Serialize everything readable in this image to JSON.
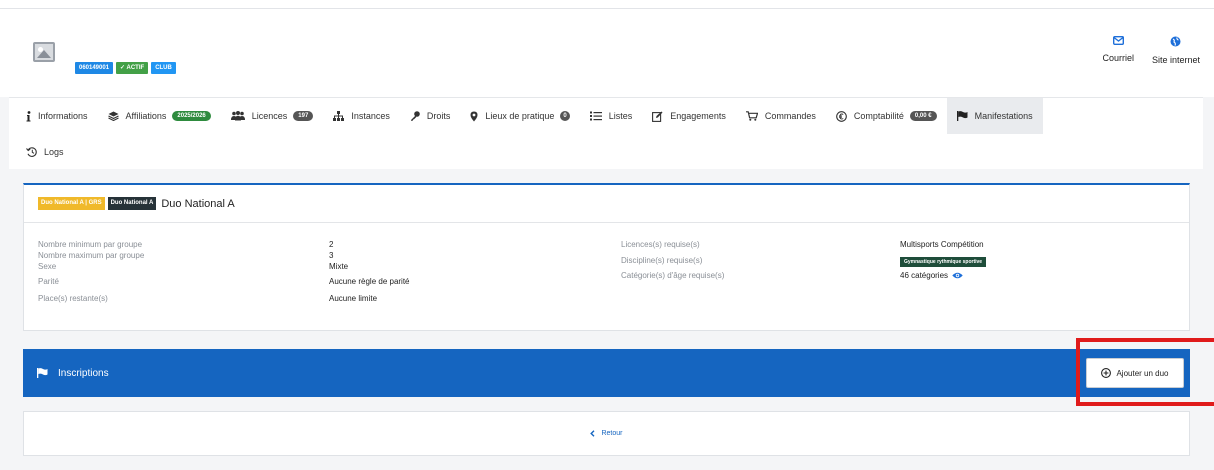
{
  "header": {
    "badges": [
      "060149001",
      "✓ ACTIF",
      "CLUB"
    ],
    "links": [
      {
        "label": "Courriel",
        "icon": "mail-icon"
      },
      {
        "label": "Site internet",
        "icon": "globe-icon"
      }
    ]
  },
  "tabs": [
    {
      "label": "Informations",
      "icon": "info-icon"
    },
    {
      "label": "Affiliations",
      "icon": "layers-icon",
      "count": "2025/2026"
    },
    {
      "label": "Licences",
      "icon": "users-icon",
      "count": "197"
    },
    {
      "label": "Instances",
      "icon": "sitemap-icon"
    },
    {
      "label": "Droits",
      "icon": "key-icon"
    },
    {
      "label": "Lieux de pratique",
      "icon": "map-marker-icon",
      "count": "0"
    },
    {
      "label": "Listes",
      "icon": "list-icon"
    },
    {
      "label": "Engagements",
      "icon": "edit-icon"
    },
    {
      "label": "Commandes",
      "icon": "cart-icon"
    },
    {
      "label": "Comptabilité",
      "icon": "euro-icon",
      "count": "0,00 €"
    },
    {
      "label": "Manifestations",
      "icon": "flag-icon"
    },
    {
      "label": "Logs",
      "icon": "history-icon"
    }
  ],
  "card": {
    "chips": [
      "Duo National A | GRS",
      "Duo National A"
    ],
    "title": "Duo National A",
    "left_labels": [
      "Nombre minimum par groupe",
      "Nombre maximum par groupe",
      "Sexe",
      "Parité",
      "Place(s) restante(s)"
    ],
    "left_values": [
      "2",
      "3",
      "Mixte",
      "Aucune règle de parité",
      "Aucune limite"
    ],
    "right_labels": [
      "Licences(s) requise(s)",
      "Discipline(s) requise(s)",
      "Catégorie(s) d'âge requise(s)"
    ],
    "licence_value": "Multisports Compétition",
    "discipline_value": "Gymnastique rythmique sportive",
    "categories_value": "46 catégories"
  },
  "inscriptions": {
    "title": "Inscriptions",
    "add_button": "Ajouter un duo"
  },
  "footer": {
    "back_label": "Retour"
  },
  "colors": {
    "primary": "#1565c0",
    "highlight": "#e01b1b",
    "active_badge": "#43a047"
  }
}
